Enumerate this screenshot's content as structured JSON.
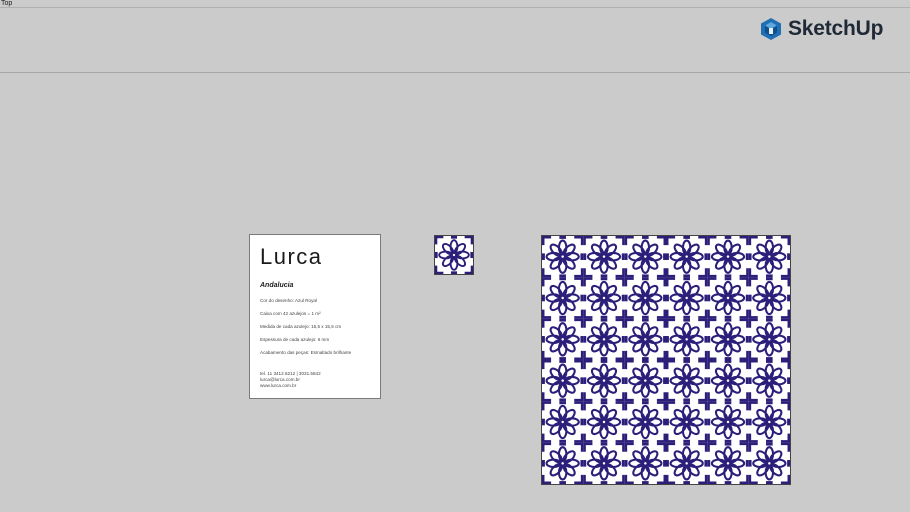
{
  "viewport": {
    "view_label": "Top"
  },
  "logo": {
    "text": "SketchUp",
    "icon": "sketchup-logo-icon",
    "color": "#1f6fb5"
  },
  "card": {
    "brand": "Lurca",
    "product_name": "Andalucia",
    "specs": [
      "Cor do desenho: Azul Royal",
      "Caixa com 42 azulejos = 1 m²",
      "Medida de cada azulejo: 15,5 x 15,5 cm",
      "Espessura de cada azulejo: 6 mm",
      "Acabamento das peças: Esmaltado brilhante"
    ],
    "contact": {
      "phone": "tel. 11 3412.6212 | 3031.5842",
      "email": "lurca@lurca.com.br",
      "website": "www.lurca.com.br"
    }
  },
  "tiles": {
    "pattern_color": "#2b1f7a",
    "grid_rows": 6,
    "grid_cols": 6
  }
}
